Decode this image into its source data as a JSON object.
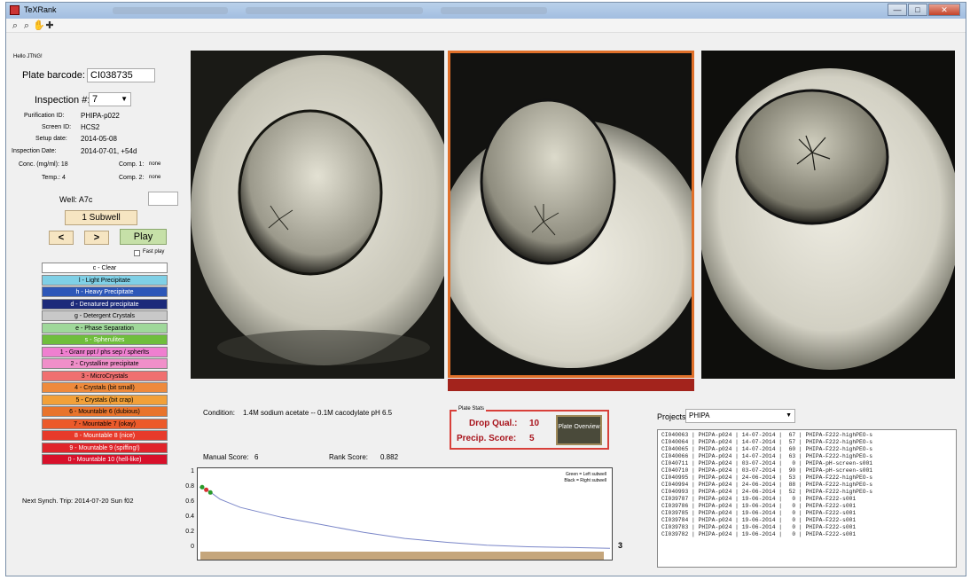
{
  "window": {
    "title": "TeXRank",
    "buttons": [
      "—",
      "□",
      "✕"
    ]
  },
  "toolbar": {
    "icons": [
      "zoom-in-icon",
      "zoom-out-icon",
      "pan-icon",
      "data-cursor-icon"
    ]
  },
  "left": {
    "greeting": "Hello JTNG!",
    "plate_barcode_label": "Plate barcode:",
    "plate_barcode": "CI038735",
    "inspection_label": "Inspection #:",
    "inspection_value": "7",
    "purification_label": "Purification ID:",
    "purification_value": "PHIPA-p022",
    "screen_label": "Screen ID:",
    "screen_value": "HCS2",
    "setup_label": "Setup date:",
    "setup_value": "2014-05-08",
    "inspection_date_label": "Inspection Date:",
    "inspection_date_value": "2014-07-01, +54d",
    "conc_label": "Conc. (mg/ml): 18",
    "comp1_label": "Comp. 1:",
    "comp1_value": "none",
    "temp_label": "Temp.: 4",
    "comp2_label": "Comp. 2:",
    "comp2_value": "none",
    "well_label": "Well: A7c",
    "well_input": "",
    "subwell_button": "1 Subwell",
    "prev_button": "<",
    "next_button": ">",
    "play_button": "Play",
    "fast_play_label": "Fast play",
    "next_synch": "Next Synch. Trip:  2014-07-20 Sun f02"
  },
  "score_buttons": [
    {
      "label": "c - Clear",
      "color": "#ffffff",
      "text": "#000000"
    },
    {
      "label": "l - Light Precipitate",
      "color": "#7fd0e6",
      "text": "#000000"
    },
    {
      "label": "h - Heavy Precipitate",
      "color": "#2d57b8",
      "text": "#ffffff"
    },
    {
      "label": "d - Denatured precipitate",
      "color": "#1c2a7a",
      "text": "#ffffff"
    },
    {
      "label": "g - Detergent Crystals",
      "color": "#c8c8c8",
      "text": "#000000"
    },
    {
      "label": "e - Phase Separation",
      "color": "#9fd89a",
      "text": "#000000"
    },
    {
      "label": "s - Spherulites",
      "color": "#6fbe3c",
      "text": "#ffffff"
    },
    {
      "label": "1 - Granr ppt / phs sep / spherlts",
      "color": "#ef7fd0",
      "text": "#000000"
    },
    {
      "label": "2 - Crystalline precipitate",
      "color": "#f08fc9",
      "text": "#000000"
    },
    {
      "label": "3 - MicroCrystals",
      "color": "#f07070",
      "text": "#000000"
    },
    {
      "label": "4 - Crystals (bit small)",
      "color": "#ee8a3c",
      "text": "#000000"
    },
    {
      "label": "5 - Crystals (bit crap)",
      "color": "#f2a038",
      "text": "#000000"
    },
    {
      "label": "6 - Mountable 6 (dubious)",
      "color": "#e8742c",
      "text": "#000000"
    },
    {
      "label": "7 - Mountable 7 (okay)",
      "color": "#ec5a2a",
      "text": "#000000"
    },
    {
      "label": "8 - Mountable 8 (nice)",
      "color": "#e73a2a",
      "text": "#ffffff"
    },
    {
      "label": "9 - Mountable 9 (spiffing!)",
      "color": "#e0242a",
      "text": "#ffffff"
    },
    {
      "label": "0 - Mountable 10 (hell-like)",
      "color": "#d8102a",
      "text": "#ffffff"
    }
  ],
  "main": {
    "condition_label": "Condition:",
    "condition_value": "1.4M sodium acetate -- 0.1M cacodylate pH 6.5",
    "manual_score_label": "Manual Score:",
    "manual_score_value": "6",
    "rank_score_label": "Rank Score:",
    "rank_score_value": "0.882",
    "plate_stats_title": "Plate Stats",
    "drop_qual_label": "Drop Qual.:",
    "drop_qual_value": "10",
    "precip_label": "Precip. Score:",
    "precip_value": "5",
    "plate_overview_button": "Plate Overview",
    "plot_count": "3",
    "legend_left": "Green = Left subwell",
    "legend_right": "Black = Right subwell"
  },
  "chart_data": {
    "type": "line",
    "ylim": [
      0,
      1
    ],
    "yticks": [
      "0",
      "0.2",
      "0.4",
      "0.6",
      "0.8",
      "1"
    ],
    "series": [
      {
        "x": [
          0,
          0.02,
          0.05,
          0.1,
          0.2,
          0.3,
          0.4,
          0.5,
          0.6,
          0.7,
          0.8,
          0.9,
          1.0
        ],
        "values": [
          0.82,
          0.78,
          0.66,
          0.55,
          0.42,
          0.32,
          0.22,
          0.14,
          0.09,
          0.05,
          0.03,
          0.02,
          0.01
        ]
      }
    ]
  },
  "projects": {
    "label": "Projects:",
    "selected": "PHIPA",
    "rows": [
      "CI040063 | PHIPA-p024 | 14-07-2014 |  67 | PHIPA-F222-highPEO-s",
      "CI040064 | PHIPA-p024 | 14-07-2014 |  57 | PHIPA-F222-highPEO-s",
      "CI040065 | PHIPA-p024 | 14-07-2014 |  60 | PHIPA-F222-highPEO-s",
      "CI040066 | PHIPA-p024 | 14-07-2014 |  63 | PHIPA-F222-highPEO-s",
      "CI040711 | PHIPA-p024 | 03-07-2014 |   0 | PHIPA-pH-screen-s001",
      "CI040710 | PHIPA-p024 | 03-07-2014 |  90 | PHIPA-pH-screen-s001",
      "CI040995 | PHIPA-p024 | 24-06-2014 |  53 | PHIPA-F222-highPEO-s",
      "CI040994 | PHIPA-p024 | 24-06-2014 |  88 | PHIPA-F222-highPEO-s",
      "CI040993 | PHIPA-p024 | 24-06-2014 |  52 | PHIPA-F222-highPEO-s",
      "CI039787 | PHIPA-p024 | 19-06-2014 |   0 | PHIPA-F222-s001",
      "CI039786 | PHIPA-p024 | 19-06-2014 |   0 | PHIPA-F222-s001",
      "CI039785 | PHIPA-p024 | 19-06-2014 |   0 | PHIPA-F222-s001",
      "CI039784 | PHIPA-p024 | 19-06-2014 |   0 | PHIPA-F222-s001",
      "CI039783 | PHIPA-p024 | 19-06-2014 |   0 | PHIPA-F222-s001",
      "CI039782 | PHIPA-p024 | 19-06-2014 |   0 | PHIPA-F222-s001"
    ]
  }
}
